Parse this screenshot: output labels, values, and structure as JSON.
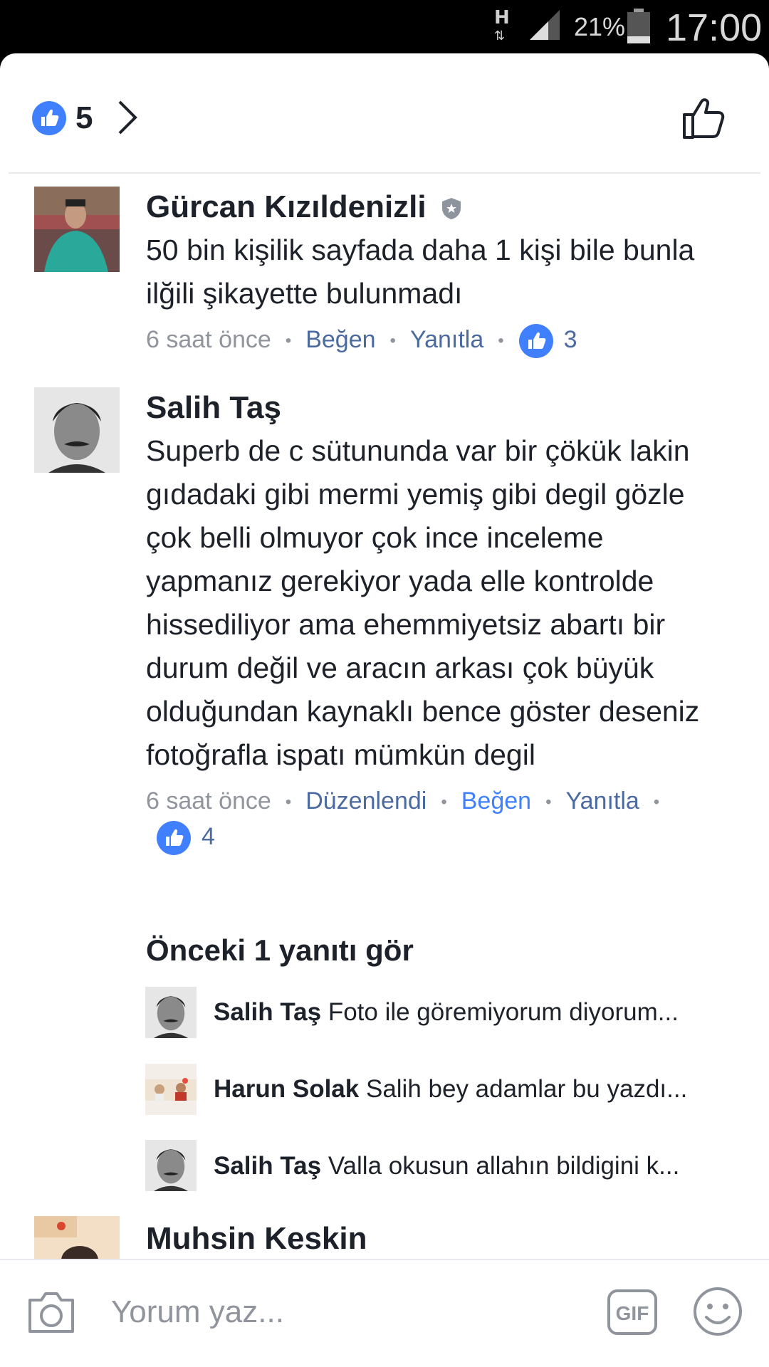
{
  "status_bar": {
    "network": "H",
    "battery_percent": "21%",
    "time": "17:00"
  },
  "reactions": {
    "count": "5"
  },
  "comments": [
    {
      "author": "Gürcan Kızıldenizli",
      "text": "50 bin kişilik sayfada daha 1 kişi bile bunla ilğili şikayette bulunmadı",
      "time": "6 saat önce",
      "like_label": "Beğen",
      "reply_label": "Yanıtla",
      "likes": "3"
    },
    {
      "author": "Salih Taş",
      "text": "Superb de c sütununda var bir çökük lakin gıdadaki gibi mermi yemiş gibi degil gözle çok belli olmuyor çok ince inceleme yapmanız gerekiyor yada elle kontrolde hissediliyor ama ehemmiyetsiz abartı bir durum değil ve aracın arkası çok büyük olduğundan kaynaklı bence göster deseniz fotoğrafla ispatı mümkün degil",
      "time": "6 saat önce",
      "edited_label": "Düzenlendi",
      "like_label": "Beğen",
      "reply_label": "Yanıtla",
      "likes": "4",
      "previous_replies_label": "Önceki 1 yanıtı gör",
      "replies": [
        {
          "author": "Salih Taş",
          "text": "Foto ile göremiyorum diyorum..."
        },
        {
          "author": "Harun Solak",
          "text": "Salih bey adamlar bu yazdı..."
        },
        {
          "author": "Salih Taş",
          "text": "Valla okusun allahın bildigini k..."
        }
      ]
    },
    {
      "author": "Muhsin Keskin"
    }
  ],
  "composer": {
    "placeholder": "Yorum yaz...",
    "gif_label": "GIF"
  },
  "colors": {
    "accent_blue": "#4b6aa0",
    "like_blue": "#4080ff",
    "text_dark": "#1d2129",
    "text_grey": "#90949c"
  }
}
